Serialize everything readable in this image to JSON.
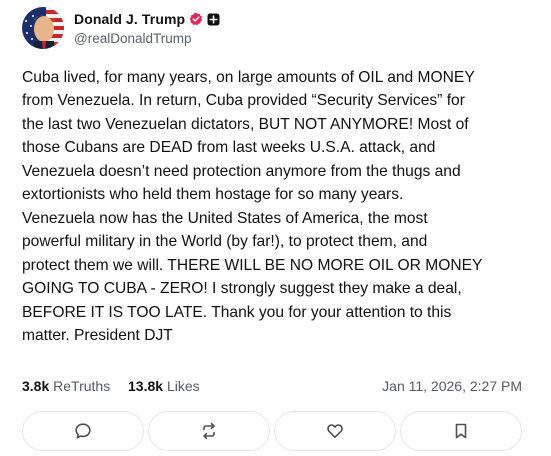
{
  "author": {
    "display_name": "Donald J. Trump",
    "handle": "@realDonaldTrump",
    "verified_icon": "verified-badge-icon",
    "verified_color": "#e0245e",
    "extra_badge_icon": "plus-square-icon"
  },
  "post": {
    "lines": [
      "Cuba lived, for many years, on large amounts of OIL and MONEY",
      "from Venezuela. In return, Cuba provided “Security Services” for",
      "the last two Venezuelan dictators, BUT NOT ANYMORE! Most of",
      "those Cubans are DEAD from last weeks U.S.A. attack, and",
      "Venezuela doesn’t need protection anymore from the thugs and",
      "extortionists who held them hostage for so many years.",
      "Venezuela now has the United States of America, the most",
      "powerful military in the World (by far!), to protect them, and",
      "protect them we will. THERE WILL BE NO MORE OIL OR MONEY",
      "GOING TO CUBA - ZERO! I strongly suggest they make a deal,",
      "BEFORE IT IS TOO LATE. Thank you for your attention to this",
      "matter. President DJT"
    ]
  },
  "stats": {
    "retruths_count": "3.8k",
    "retruths_label": "ReTruths",
    "likes_count": "13.8k",
    "likes_label": "Likes",
    "timestamp": "Jan 11, 2026, 2:27 PM"
  },
  "actions": [
    {
      "icon": "reply-icon"
    },
    {
      "icon": "retruth-icon"
    },
    {
      "icon": "like-heart-icon"
    },
    {
      "icon": "bookmark-icon"
    }
  ]
}
